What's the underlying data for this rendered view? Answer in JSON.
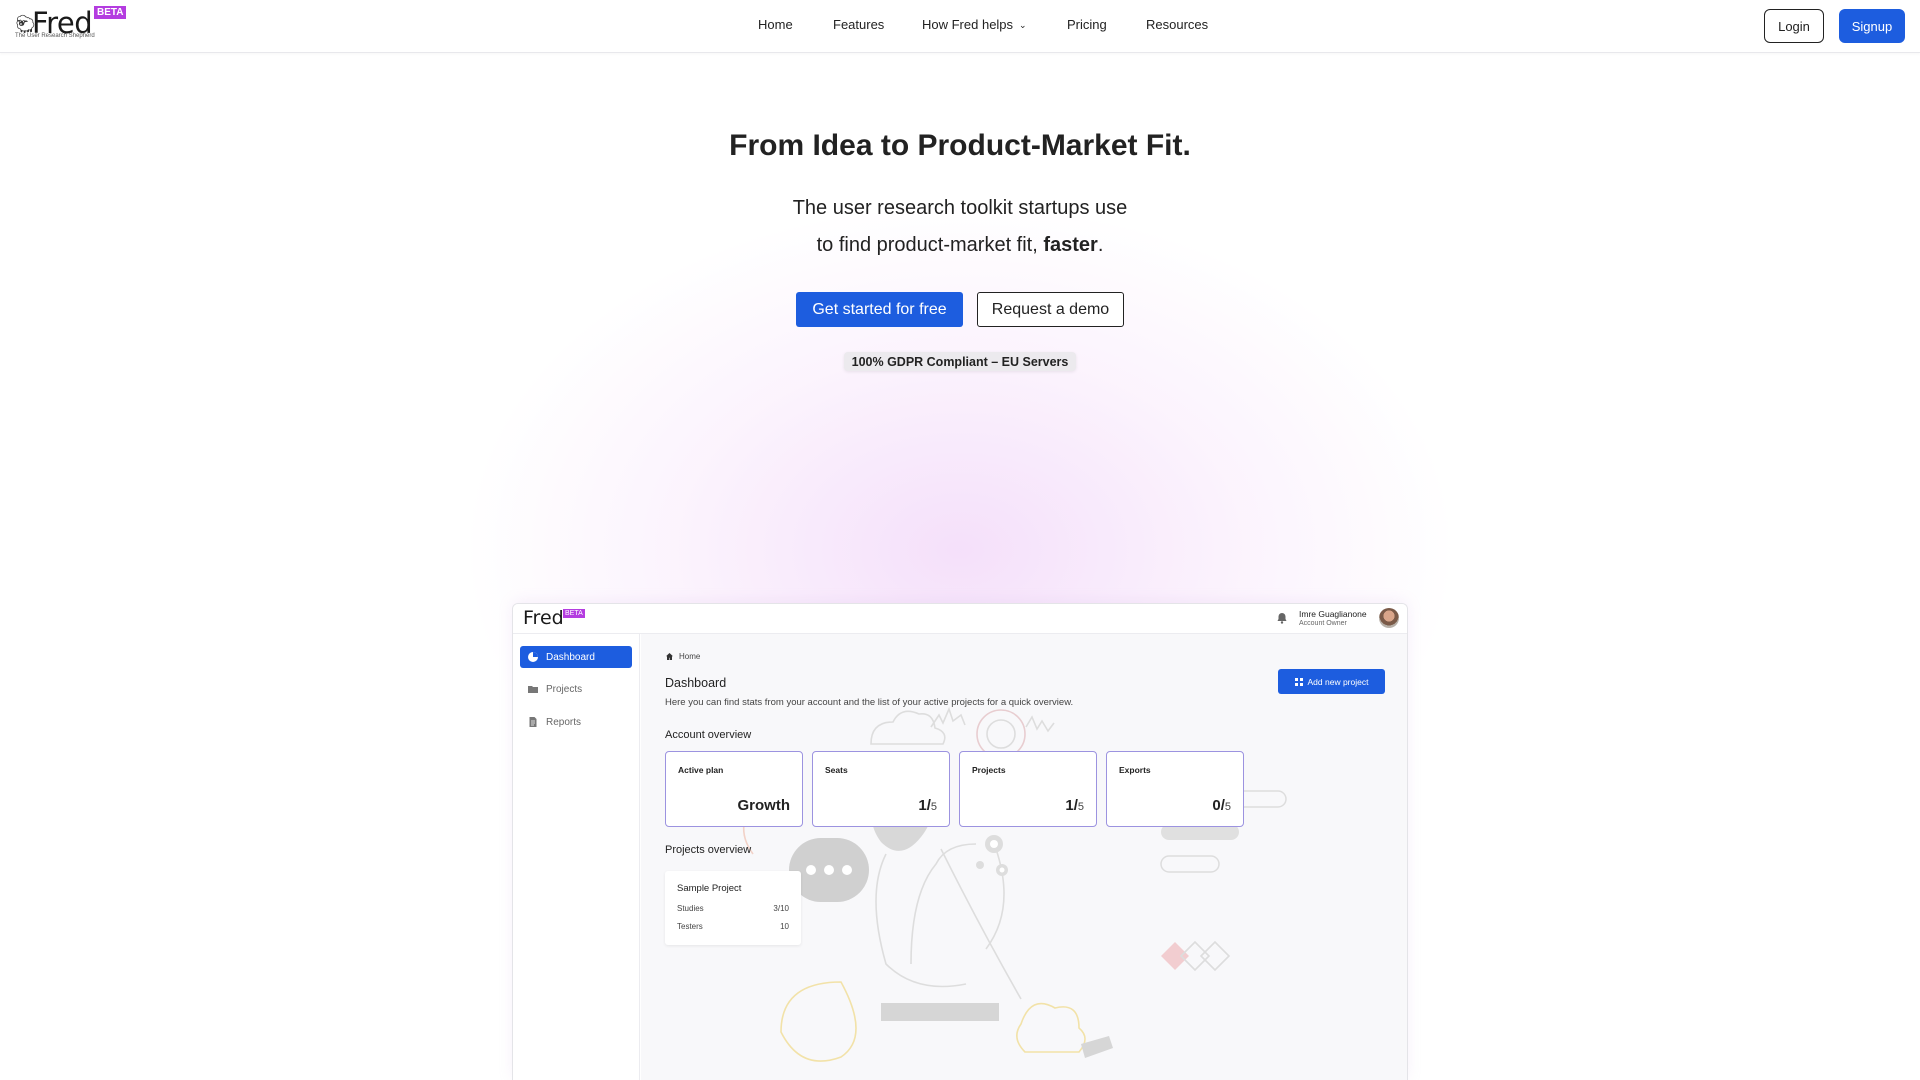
{
  "nav": {
    "logo_word": "Fred",
    "logo_beta": "BETA",
    "logo_tagline": "The User Research Shepherd",
    "items": [
      {
        "label": "Home"
      },
      {
        "label": "Features"
      },
      {
        "label": "How Fred helps"
      },
      {
        "label": "Pricing"
      },
      {
        "label": "Resources"
      }
    ],
    "login_label": "Login",
    "signup_label": "Signup"
  },
  "hero": {
    "title": "From Idea to Product-Market Fit.",
    "subtitle_line1": "The user research toolkit startups use",
    "subtitle_line2_pre": "to find product-market fit, ",
    "subtitle_line2_bold": "faster",
    "subtitle_line2_post": ".",
    "cta_primary": "Get started for free",
    "cta_secondary": "Request a demo",
    "badge": "100% GDPR Compliant – EU Servers"
  },
  "app": {
    "logo_word": "Fred",
    "logo_beta": "BETA",
    "user": {
      "name": "Imre Guaglianone",
      "role": "Account Owner"
    },
    "sidebar": [
      {
        "label": "Dashboard",
        "icon": "pie-chart-icon",
        "active": true
      },
      {
        "label": "Projects",
        "icon": "folder-icon",
        "active": false
      },
      {
        "label": "Reports",
        "icon": "document-icon",
        "active": false
      }
    ],
    "breadcrumb": "Home",
    "title": "Dashboard",
    "description": "Here you can find stats from your account and the list of your active projects for a quick overview.",
    "add_button": "Add new project",
    "account_overview_title": "Account overview",
    "cards": [
      {
        "label": "Active plan",
        "value": "Growth",
        "max": ""
      },
      {
        "label": "Seats",
        "value": "1/",
        "max": "5"
      },
      {
        "label": "Projects",
        "value": "1/",
        "max": "5"
      },
      {
        "label": "Exports",
        "value": "0/",
        "max": "5"
      }
    ],
    "projects_overview_title": "Projects overview",
    "project": {
      "name": "Sample Project",
      "rows": [
        {
          "label": "Studies",
          "value": "3/10"
        },
        {
          "label": "Testers",
          "value": "10"
        }
      ]
    }
  },
  "colors": {
    "primary": "#1d5ddf",
    "beta": "#b43ce0",
    "card_border": "#9c93e0"
  }
}
